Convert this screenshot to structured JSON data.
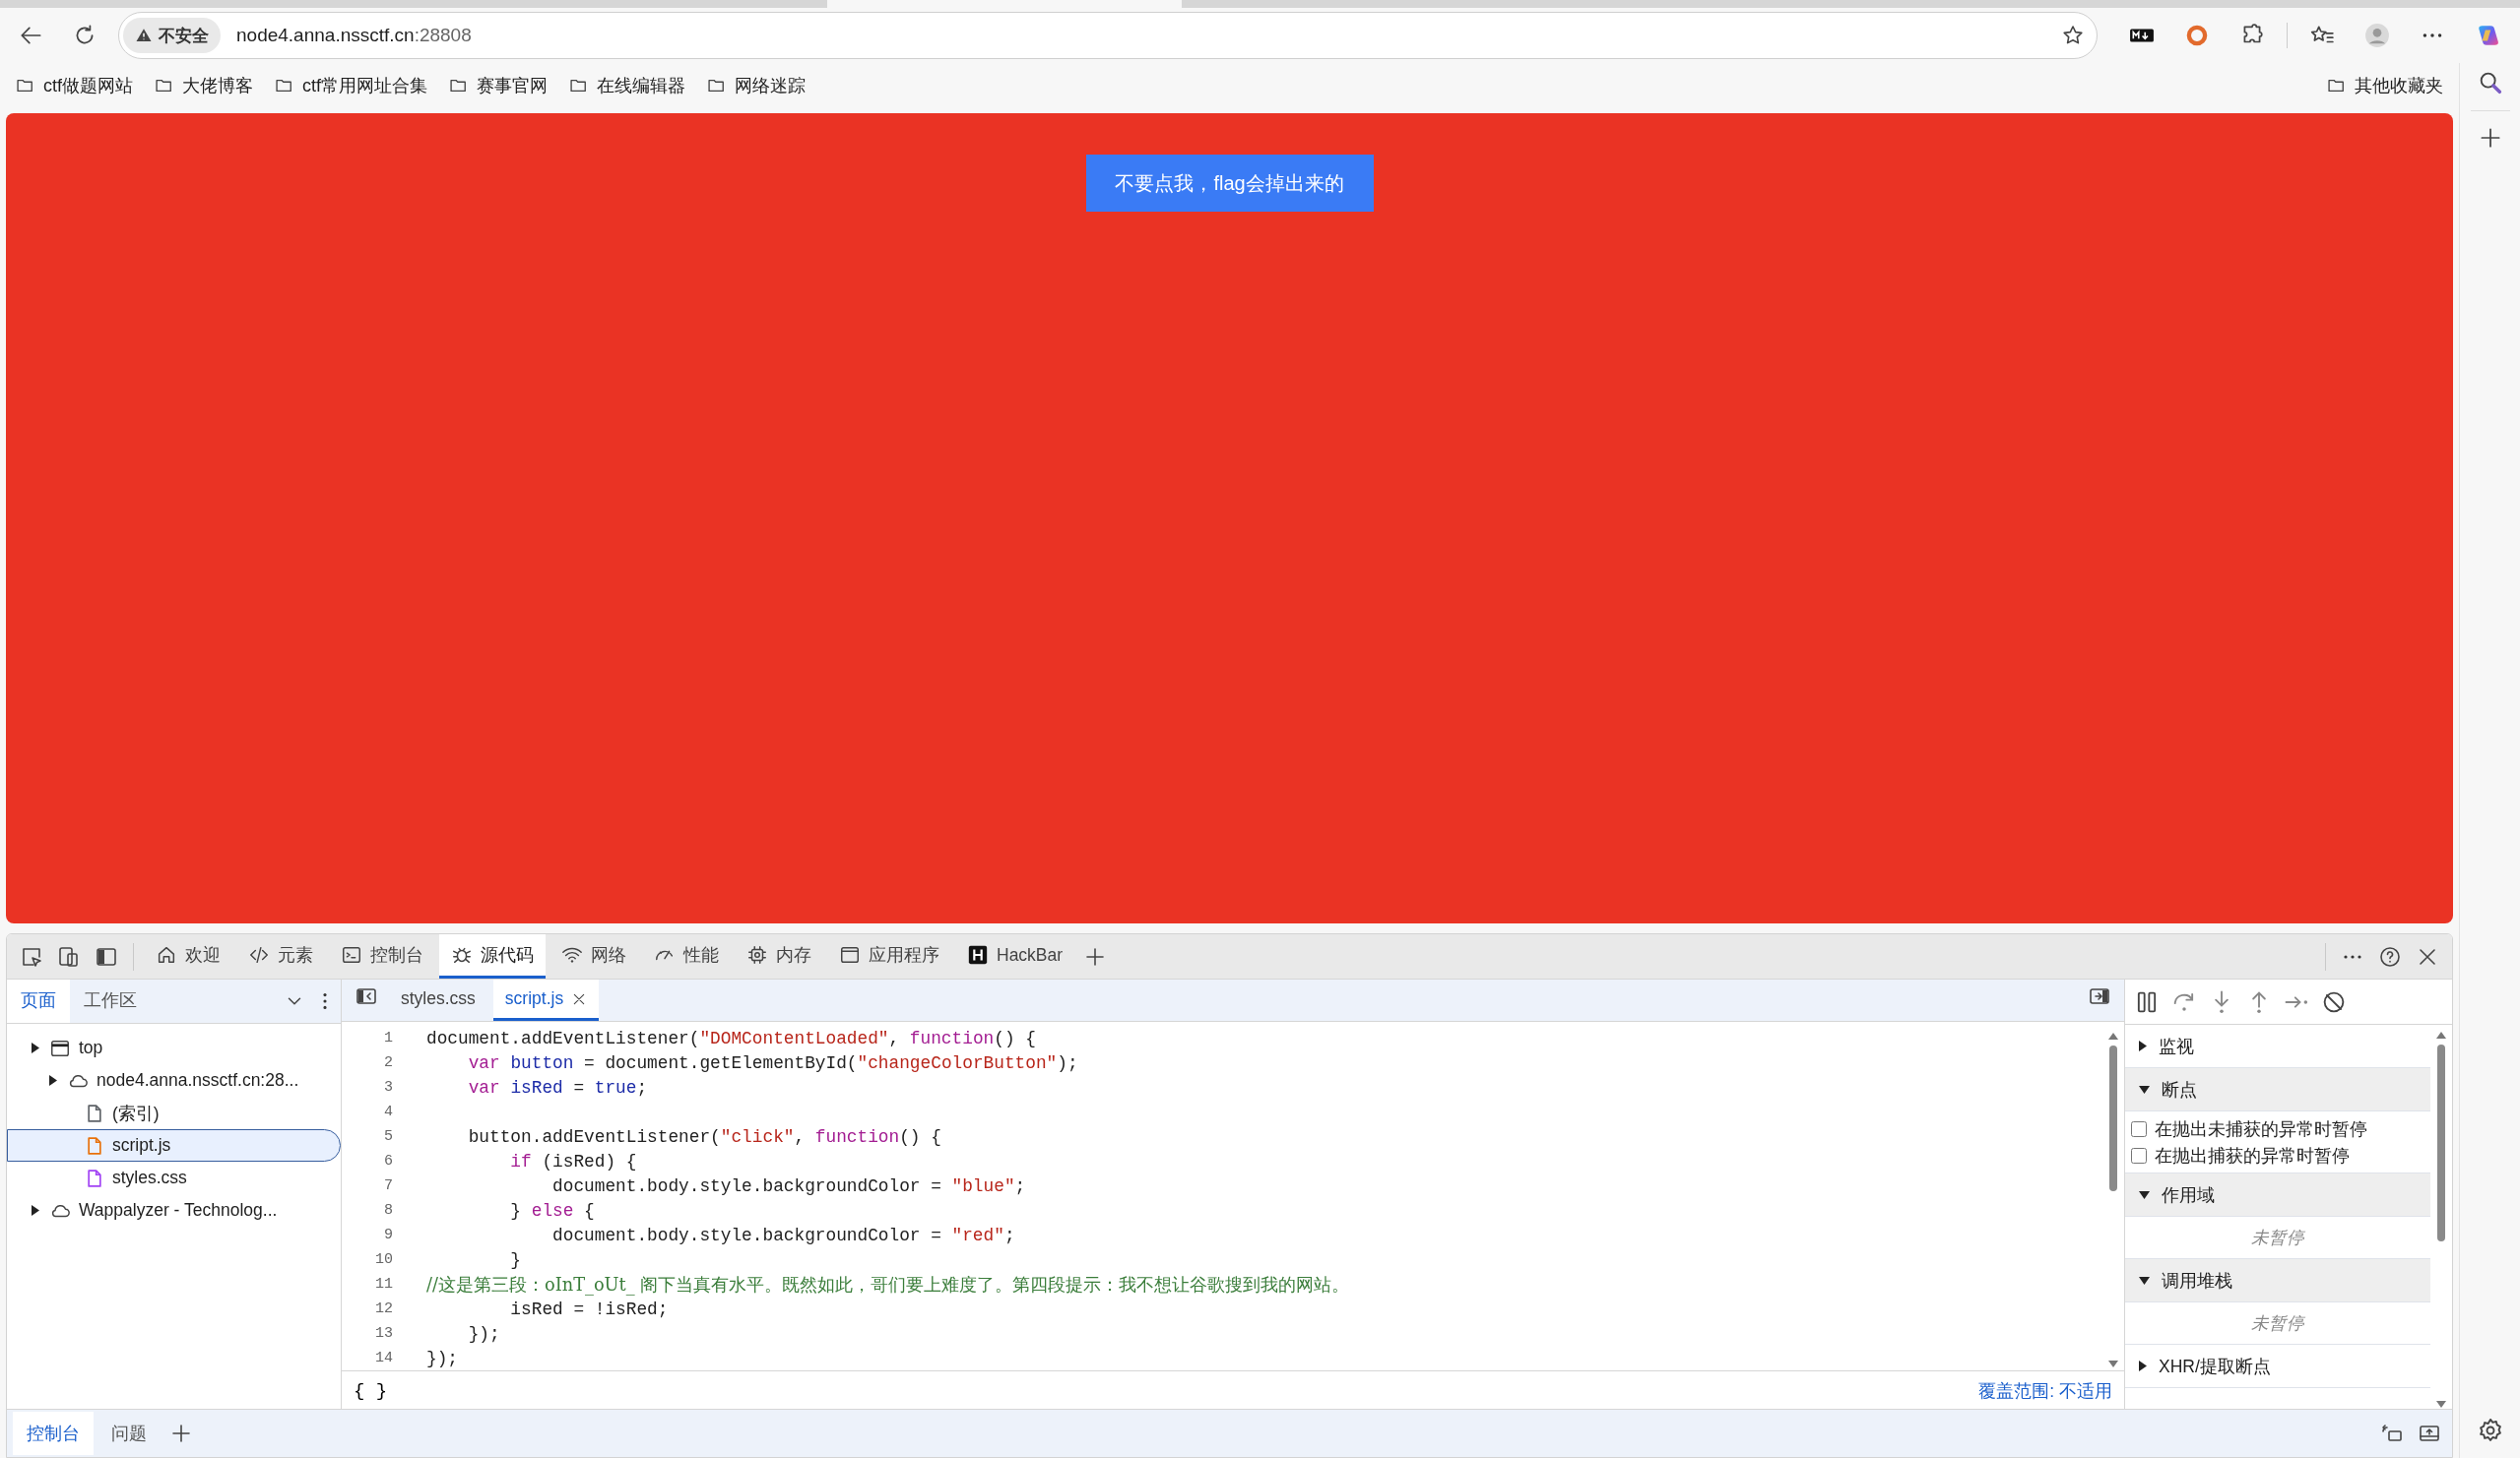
{
  "browser": {
    "address": {
      "security_label": "不安全",
      "host": "node4.anna.nssctf.cn",
      "port": ":28808"
    },
    "bookmarks": [
      {
        "label": "ctf做题网站"
      },
      {
        "label": "大佬博客"
      },
      {
        "label": "ctf常用网址合集"
      },
      {
        "label": "赛事官网"
      },
      {
        "label": "在线编辑器"
      },
      {
        "label": "网络迷踪"
      }
    ],
    "other_bookmarks": "其他收藏夹"
  },
  "page": {
    "button": "不要点我，flag会掉出来的"
  },
  "devtools": {
    "tabs": [
      {
        "label": "欢迎",
        "selected": false
      },
      {
        "label": "元素",
        "selected": false
      },
      {
        "label": "控制台",
        "selected": false
      },
      {
        "label": "源代码",
        "selected": true
      },
      {
        "label": "网络",
        "selected": false
      },
      {
        "label": "性能",
        "selected": false
      },
      {
        "label": "内存",
        "selected": false
      },
      {
        "label": "应用程序",
        "selected": false
      },
      {
        "label": "HackBar",
        "selected": false
      }
    ],
    "navigator": {
      "tabs": [
        {
          "label": "页面",
          "selected": true
        },
        {
          "label": "工作区",
          "selected": false
        }
      ],
      "tree": [
        {
          "label": "top",
          "kind": "frame",
          "children": [
            {
              "label": "node4.anna.nssctf.cn:28...",
              "kind": "domain",
              "children": [
                {
                  "label": "(索引)",
                  "kind": "file",
                  "color": "#5f6368",
                  "selected": false
                },
                {
                  "label": "script.js",
                  "kind": "file",
                  "color": "#e8710a",
                  "selected": true
                },
                {
                  "label": "styles.css",
                  "kind": "file",
                  "color": "#a142f4",
                  "selected": false
                }
              ]
            }
          ]
        },
        {
          "label": "Wappalyzer - Technolog...",
          "kind": "domain"
        }
      ]
    },
    "editor": {
      "tabs": [
        {
          "label": "styles.css",
          "selected": false,
          "closable": false
        },
        {
          "label": "script.js",
          "selected": true,
          "closable": true
        }
      ],
      "lines": [
        {
          "number": "1",
          "tokens": [
            {
              "t": "document.addEventListener(",
              "kind": "plain"
            },
            {
              "t": "\"DOMContentLoaded\"",
              "kind": "string"
            },
            {
              "t": ", ",
              "kind": "plain"
            },
            {
              "t": "function",
              "kind": "keyword"
            },
            {
              "t": "() {",
              "kind": "plain"
            }
          ]
        },
        {
          "number": "2",
          "tokens": [
            {
              "t": "    var ",
              "kind": "keyword"
            },
            {
              "t": "button",
              "kind": "name"
            },
            {
              "t": " = document.getElementById(",
              "kind": "plain"
            },
            {
              "t": "\"changeColorButton\"",
              "kind": "string"
            },
            {
              "t": ");",
              "kind": "plain"
            }
          ]
        },
        {
          "number": "3",
          "tokens": [
            {
              "t": "    var ",
              "kind": "keyword"
            },
            {
              "t": "isRed",
              "kind": "name"
            },
            {
              "t": " = ",
              "kind": "plain"
            },
            {
              "t": "true",
              "kind": "name"
            },
            {
              "t": ";",
              "kind": "plain"
            }
          ]
        },
        {
          "number": "4"
        },
        {
          "number": "5",
          "tokens": [
            {
              "t": "    button.addEventListener(",
              "kind": "plain"
            },
            {
              "t": "\"click\"",
              "kind": "string"
            },
            {
              "t": ", ",
              "kind": "plain"
            },
            {
              "t": "function",
              "kind": "keyword"
            },
            {
              "t": "() {",
              "kind": "plain"
            }
          ]
        },
        {
          "number": "6",
          "tokens": [
            {
              "t": "        if",
              "kind": "keyword"
            },
            {
              "t": " (isRed) {",
              "kind": "plain"
            }
          ]
        },
        {
          "number": "7",
          "tokens": [
            {
              "t": "            document.body.style.backgroundColor = ",
              "kind": "plain"
            },
            {
              "t": "\"blue\"",
              "kind": "string"
            },
            {
              "t": ";",
              "kind": "plain"
            }
          ]
        },
        {
          "number": "8",
          "tokens": [
            {
              "t": "        } ",
              "kind": "plain"
            },
            {
              "t": "else",
              "kind": "keyword"
            },
            {
              "t": " {",
              "kind": "plain"
            }
          ]
        },
        {
          "number": "9",
          "tokens": [
            {
              "t": "            document.body.style.backgroundColor = ",
              "kind": "plain"
            },
            {
              "t": "\"red\"",
              "kind": "string"
            },
            {
              "t": ";",
              "kind": "plain"
            }
          ]
        },
        {
          "number": "10",
          "tokens": [
            {
              "t": "        }",
              "kind": "plain"
            }
          ]
        },
        {
          "number": "11",
          "tokens": [
            {
              "t": "//这是第三段：oInT_oUt_ 阁下当真有水平。既然如此，哥们要上难度了。第四段提示：我不想让谷歌搜到我的网站。",
              "kind": "comment"
            }
          ]
        },
        {
          "number": "12",
          "tokens": [
            {
              "t": "        isRed = !isRed;",
              "kind": "plain"
            }
          ]
        },
        {
          "number": "13",
          "tokens": [
            {
              "t": "    });",
              "kind": "plain"
            }
          ]
        },
        {
          "number": "14",
          "tokens": [
            {
              "t": "});",
              "kind": "plain"
            }
          ]
        }
      ],
      "format_button": "{ }",
      "coverage": "覆盖范围: 不适用"
    },
    "debugger": {
      "sections": [
        {
          "title": "监视",
          "expanded": false
        },
        {
          "title": "断点",
          "expanded": true,
          "checkboxes": [
            {
              "label": "在抛出未捕获的异常时暂停",
              "checked": false
            },
            {
              "label": "在抛出捕获的异常时暂停",
              "checked": false
            }
          ]
        },
        {
          "title": "作用域",
          "expanded": true,
          "message": "未暂停"
        },
        {
          "title": "调用堆栈",
          "expanded": true,
          "message": "未暂停"
        },
        {
          "title": "XHR/提取断点",
          "expanded": false
        }
      ]
    },
    "drawer": {
      "tabs": [
        {
          "label": "控制台",
          "selected": true
        },
        {
          "label": "问题",
          "selected": false
        }
      ]
    }
  }
}
